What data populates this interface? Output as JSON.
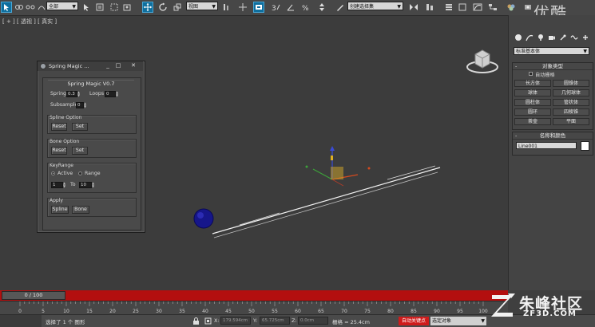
{
  "toolbar": {
    "filter_dropdown": "全部",
    "coord_dropdown": "视图",
    "named_selection_dropdown": "创建选择集",
    "icons": [
      "select-object-icon",
      "link-icon",
      "unlink-icon",
      "bind-spacewarp-icon",
      "select-by-name-icon",
      "rect-region-icon",
      "window-crossing-icon",
      "select-move-icon",
      "select-rotate-icon",
      "select-scale-icon",
      "pivot-icon",
      "keyboard-shortcut-icon",
      "snap-3d-icon",
      "angle-snap-icon",
      "percent-snap-icon",
      "spinner-snap-icon",
      "edit-named-selection-icon",
      "mirror-icon",
      "align-icon",
      "layer-manager-icon",
      "curve-editor-icon",
      "schematic-icon",
      "material-editor-icon",
      "render-setup-icon",
      "rendered-frame-icon",
      "render-icon"
    ]
  },
  "viewport": {
    "label": "[ + ] [ 透视 ] [ 真实 ]"
  },
  "spring_magic": {
    "title": "Spring Magic ...",
    "header": "Spring Magic V0.7",
    "spring_label": "Spring",
    "spring_value": "0.3",
    "loops_label": "Loops",
    "loops_value": "0",
    "subsample_label": "Subsample",
    "subsample_value": "0",
    "spline_group": "Spline Option",
    "bone_group": "Bone Option",
    "reset_label": "Reset",
    "set_label": "Set",
    "keyrange_group": "KeyRange",
    "active_label": "Active",
    "range_label": "Range",
    "range_from": "1",
    "to_label": "To",
    "range_to": "10",
    "apply_group": "Apply",
    "spline_btn": "Spline",
    "bone_btn": "Bone",
    "minimize": "_",
    "maximize": "□",
    "close": "✕"
  },
  "command_panel": {
    "category_dropdown": "标准基本体",
    "object_type_title": "对象类型",
    "autogrid_label": "自动栅格",
    "objects": [
      "长方体",
      "圆锥体",
      "球体",
      "几何球体",
      "圆柱体",
      "管状体",
      "圆环",
      "四棱锥",
      "茶壶",
      "平面"
    ],
    "name_color_title": "名称和颜色",
    "object_name": "Line001",
    "object_color": "#ffffff"
  },
  "timeline": {
    "frame_display": "0 / 100",
    "ticks": [
      "0",
      "5",
      "10",
      "15",
      "20",
      "25",
      "30",
      "35",
      "40",
      "45",
      "50",
      "55",
      "60",
      "65",
      "70",
      "75",
      "80",
      "85",
      "90",
      "95",
      "100"
    ]
  },
  "status": {
    "message": "选择了 1 个 图形",
    "x_label": "X:",
    "x_value": "179.594cm",
    "y_label": "Y:",
    "y_value": "65.725cm",
    "z_label": "Z:",
    "z_value": "0.0cm",
    "grid": "栅格 = 25.4cm",
    "autokey": "自动关键点",
    "selection_filter": "选定对象"
  },
  "watermark": {
    "top": "优酷",
    "site_name": "朱峰社区",
    "url": "ZF3D.COM"
  }
}
